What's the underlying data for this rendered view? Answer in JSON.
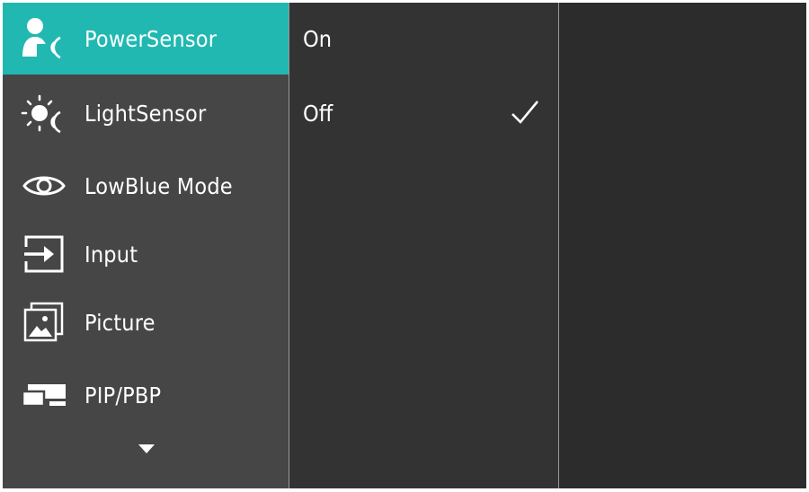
{
  "main_menu": {
    "items": [
      {
        "label": "PowerSensor",
        "icon": "power-sensor-icon",
        "selected": true
      },
      {
        "label": "LightSensor",
        "icon": "light-sensor-icon",
        "selected": false
      },
      {
        "label": "LowBlue Mode",
        "icon": "eye-icon",
        "selected": false
      },
      {
        "label": "Input",
        "icon": "input-icon",
        "selected": false
      },
      {
        "label": "Picture",
        "icon": "picture-icon",
        "selected": false
      },
      {
        "label": "PIP/PBP",
        "icon": "pip-pbp-icon",
        "selected": false
      }
    ],
    "more_icon": "chevron-down-icon"
  },
  "submenu": {
    "items": [
      {
        "label": "On",
        "checked": false
      },
      {
        "label": "Off",
        "checked": true
      }
    ],
    "check_icon": "checkmark-icon"
  },
  "colors": {
    "accent": "#21b8b2",
    "main_menu_bg": "#464646",
    "submenu_bg": "#333333",
    "panel_bg": "#2c2c2c",
    "text": "#ffffff"
  }
}
